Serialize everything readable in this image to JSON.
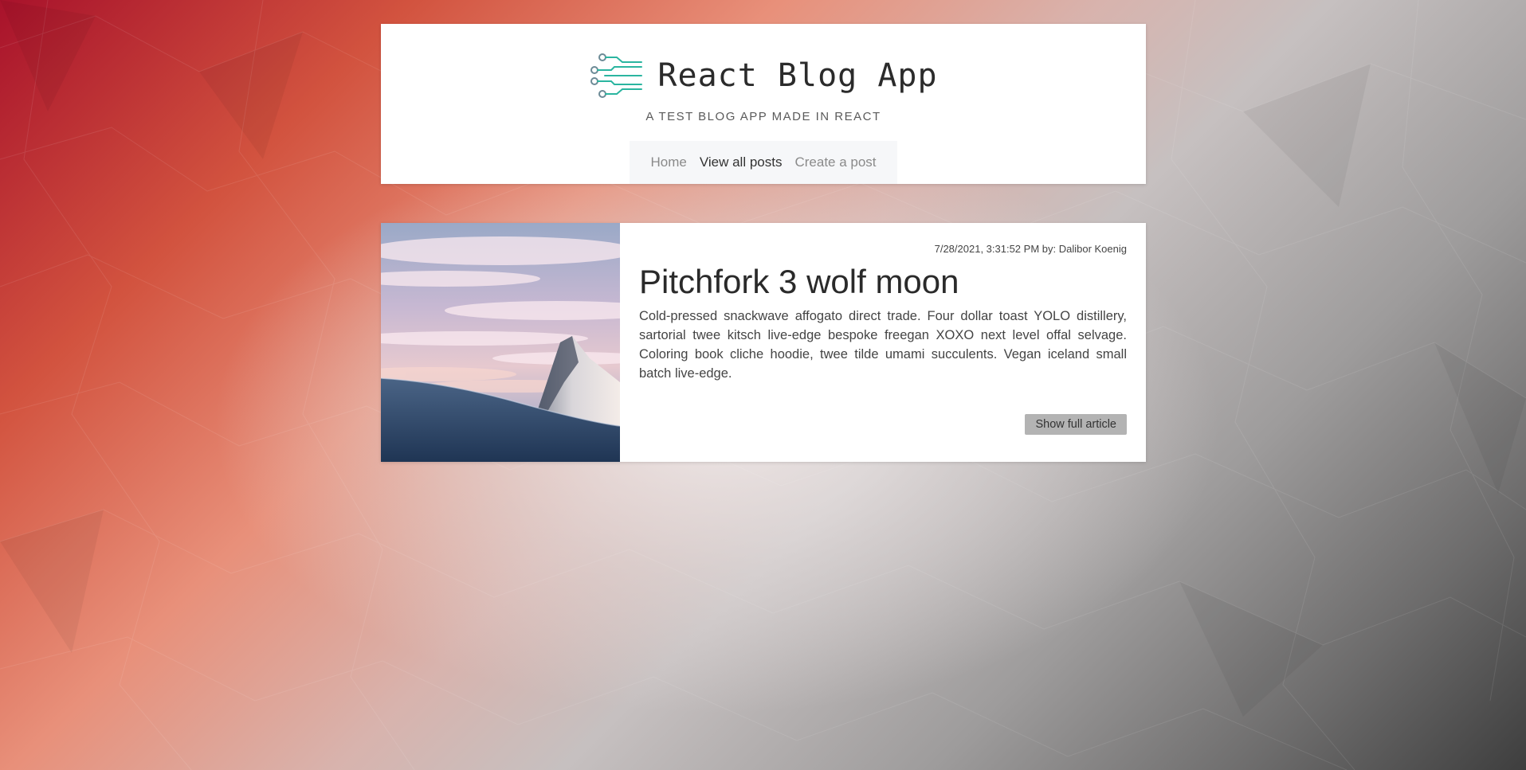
{
  "header": {
    "title": "React Blog App",
    "tagline": "A TEST BLOG APP MADE IN REACT"
  },
  "nav": {
    "items": [
      {
        "label": "Home",
        "active": false
      },
      {
        "label": "View all posts",
        "active": true
      },
      {
        "label": "Create a post",
        "active": false
      }
    ]
  },
  "posts": [
    {
      "meta": "7/28/2021, 3:31:52 PM by: Dalibor Koenig",
      "title": "Pitchfork 3 wolf moon",
      "excerpt": "Cold-pressed snackwave affogato direct trade. Four dollar toast YOLO distillery, sartorial twee kitsch live-edge bespoke freegan XOXO next level offal selvage. Coloring book cliche hoodie, twee tilde umami succulents. Vegan iceland small batch live-edge.",
      "button_label": "Show full article",
      "image": "mountain-peak-photo"
    }
  ],
  "colors": {
    "logo_accent": "#2bb5a0",
    "nav_background": "#f6f7f9",
    "button_background": "#b3b3b3",
    "background_warm": "#c8213a",
    "background_dark": "#3e3e3e"
  },
  "icons": {
    "brand_logo": "circuit-lines-icon"
  }
}
